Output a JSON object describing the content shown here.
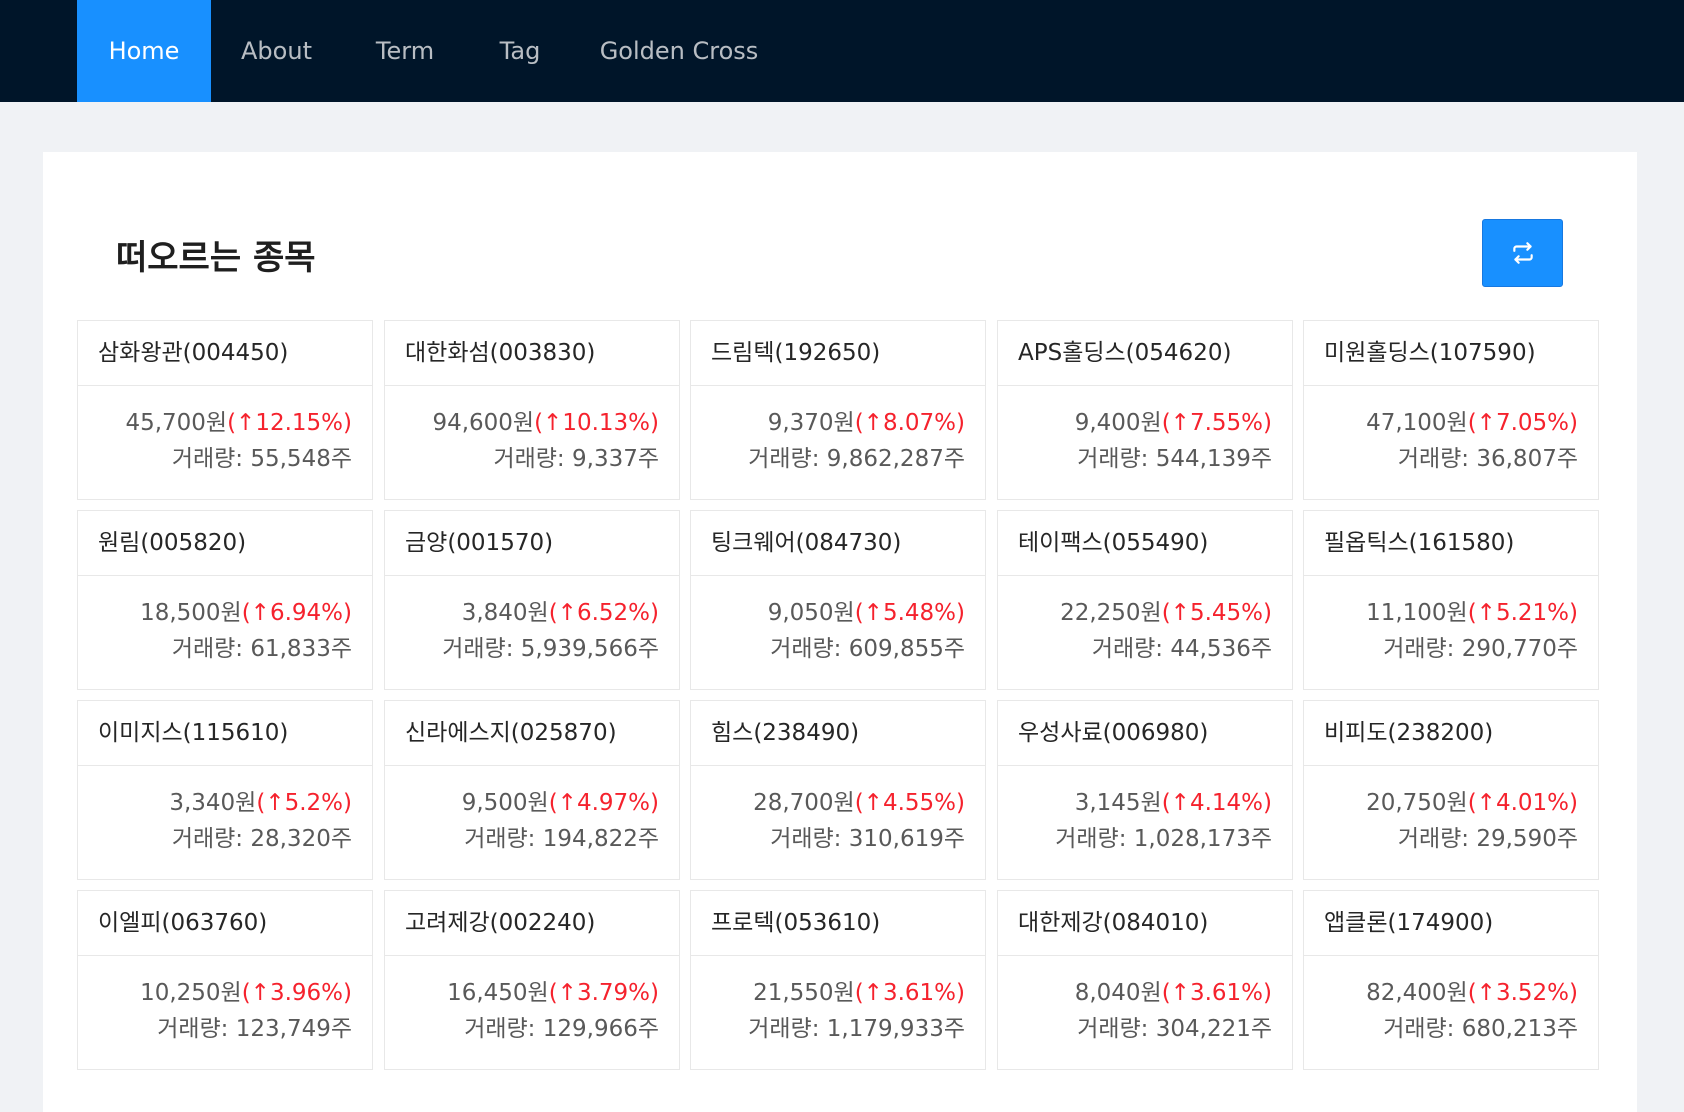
{
  "nav": {
    "items": [
      {
        "label": "Home",
        "active": true
      },
      {
        "label": "About",
        "active": false
      },
      {
        "label": "Term",
        "active": false
      },
      {
        "label": "Tag",
        "active": false
      },
      {
        "label": "Golden Cross",
        "active": false
      }
    ]
  },
  "page": {
    "title": "떠오르는 종목",
    "refresh_icon": "swap-icon"
  },
  "colors": {
    "nav_bg": "#001529",
    "accent": "#1890ff",
    "rise": "#f5222d",
    "page_bg": "#f0f2f5"
  },
  "stocks": [
    {
      "name": "삼화왕관(004450)",
      "price": "45,700원",
      "change": "(↑12.15%)",
      "volume": "거래량: 55,548주"
    },
    {
      "name": "대한화섬(003830)",
      "price": "94,600원",
      "change": "(↑10.13%)",
      "volume": "거래량: 9,337주"
    },
    {
      "name": "드림텍(192650)",
      "price": "9,370원",
      "change": "(↑8.07%)",
      "volume": "거래량: 9,862,287주"
    },
    {
      "name": "APS홀딩스(054620)",
      "price": "9,400원",
      "change": "(↑7.55%)",
      "volume": "거래량: 544,139주"
    },
    {
      "name": "미원홀딩스(107590)",
      "price": "47,100원",
      "change": "(↑7.05%)",
      "volume": "거래량: 36,807주"
    },
    {
      "name": "원림(005820)",
      "price": "18,500원",
      "change": "(↑6.94%)",
      "volume": "거래량: 61,833주"
    },
    {
      "name": "금양(001570)",
      "price": "3,840원",
      "change": "(↑6.52%)",
      "volume": "거래량: 5,939,566주"
    },
    {
      "name": "팅크웨어(084730)",
      "price": "9,050원",
      "change": "(↑5.48%)",
      "volume": "거래량: 609,855주"
    },
    {
      "name": "테이팩스(055490)",
      "price": "22,250원",
      "change": "(↑5.45%)",
      "volume": "거래량: 44,536주"
    },
    {
      "name": "필옵틱스(161580)",
      "price": "11,100원",
      "change": "(↑5.21%)",
      "volume": "거래량: 290,770주"
    },
    {
      "name": "이미지스(115610)",
      "price": "3,340원",
      "change": "(↑5.2%)",
      "volume": "거래량: 28,320주"
    },
    {
      "name": "신라에스지(025870)",
      "price": "9,500원",
      "change": "(↑4.97%)",
      "volume": "거래량: 194,822주"
    },
    {
      "name": "힘스(238490)",
      "price": "28,700원",
      "change": "(↑4.55%)",
      "volume": "거래량: 310,619주"
    },
    {
      "name": "우성사료(006980)",
      "price": "3,145원",
      "change": "(↑4.14%)",
      "volume": "거래량: 1,028,173주"
    },
    {
      "name": "비피도(238200)",
      "price": "20,750원",
      "change": "(↑4.01%)",
      "volume": "거래량: 29,590주"
    },
    {
      "name": "이엘피(063760)",
      "price": "10,250원",
      "change": "(↑3.96%)",
      "volume": "거래량: 123,749주"
    },
    {
      "name": "고려제강(002240)",
      "price": "16,450원",
      "change": "(↑3.79%)",
      "volume": "거래량: 129,966주"
    },
    {
      "name": "프로텍(053610)",
      "price": "21,550원",
      "change": "(↑3.61%)",
      "volume": "거래량: 1,179,933주"
    },
    {
      "name": "대한제강(084010)",
      "price": "8,040원",
      "change": "(↑3.61%)",
      "volume": "거래량: 304,221주"
    },
    {
      "name": "앱클론(174900)",
      "price": "82,400원",
      "change": "(↑3.52%)",
      "volume": "거래량: 680,213주"
    }
  ]
}
